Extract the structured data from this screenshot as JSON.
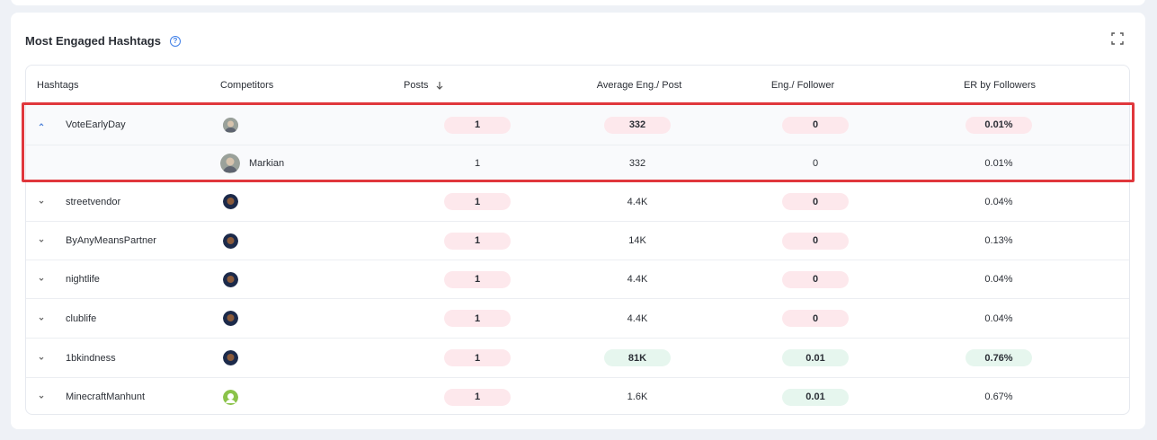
{
  "section": {
    "title": "Most Engaged Hashtags"
  },
  "columns": {
    "hashtags": "Hashtags",
    "competitors": "Competitors",
    "posts": "Posts",
    "avg_eng": "Average Eng./ Post",
    "eng_follower": "Eng./ Follower",
    "er_followers": "ER by Followers"
  },
  "rows": [
    {
      "hashtag": "VoteEarlyDay",
      "expanded": true,
      "posts": "1",
      "avg": "332",
      "engf": "0",
      "er": "0.01%"
    },
    {
      "hashtag": "streetvendor",
      "expanded": false,
      "posts": "1",
      "avg": "4.4K",
      "engf": "0",
      "er": "0.04%"
    },
    {
      "hashtag": "ByAnyMeansPartner",
      "expanded": false,
      "posts": "1",
      "avg": "14K",
      "engf": "0",
      "er": "0.13%"
    },
    {
      "hashtag": "nightlife",
      "expanded": false,
      "posts": "1",
      "avg": "4.4K",
      "engf": "0",
      "er": "0.04%"
    },
    {
      "hashtag": "clublife",
      "expanded": false,
      "posts": "1",
      "avg": "4.4K",
      "engf": "0",
      "er": "0.04%"
    },
    {
      "hashtag": "1bkindness",
      "expanded": false,
      "posts": "1",
      "avg": "81K",
      "engf": "0.01",
      "er": "0.76%"
    },
    {
      "hashtag": "MinecraftManhunt",
      "expanded": false,
      "posts": "1",
      "avg": "1.6K",
      "engf": "0.01",
      "er": "0.67%"
    }
  ],
  "subrow": {
    "competitor": "Markian",
    "posts": "1",
    "avg": "332",
    "engf": "0",
    "er": "0.01%"
  },
  "colors": {
    "pink_pill": "#fde8ec",
    "green_pill": "#e6f6ee",
    "highlight": "#e0373c",
    "accent": "#3f7fe8"
  }
}
